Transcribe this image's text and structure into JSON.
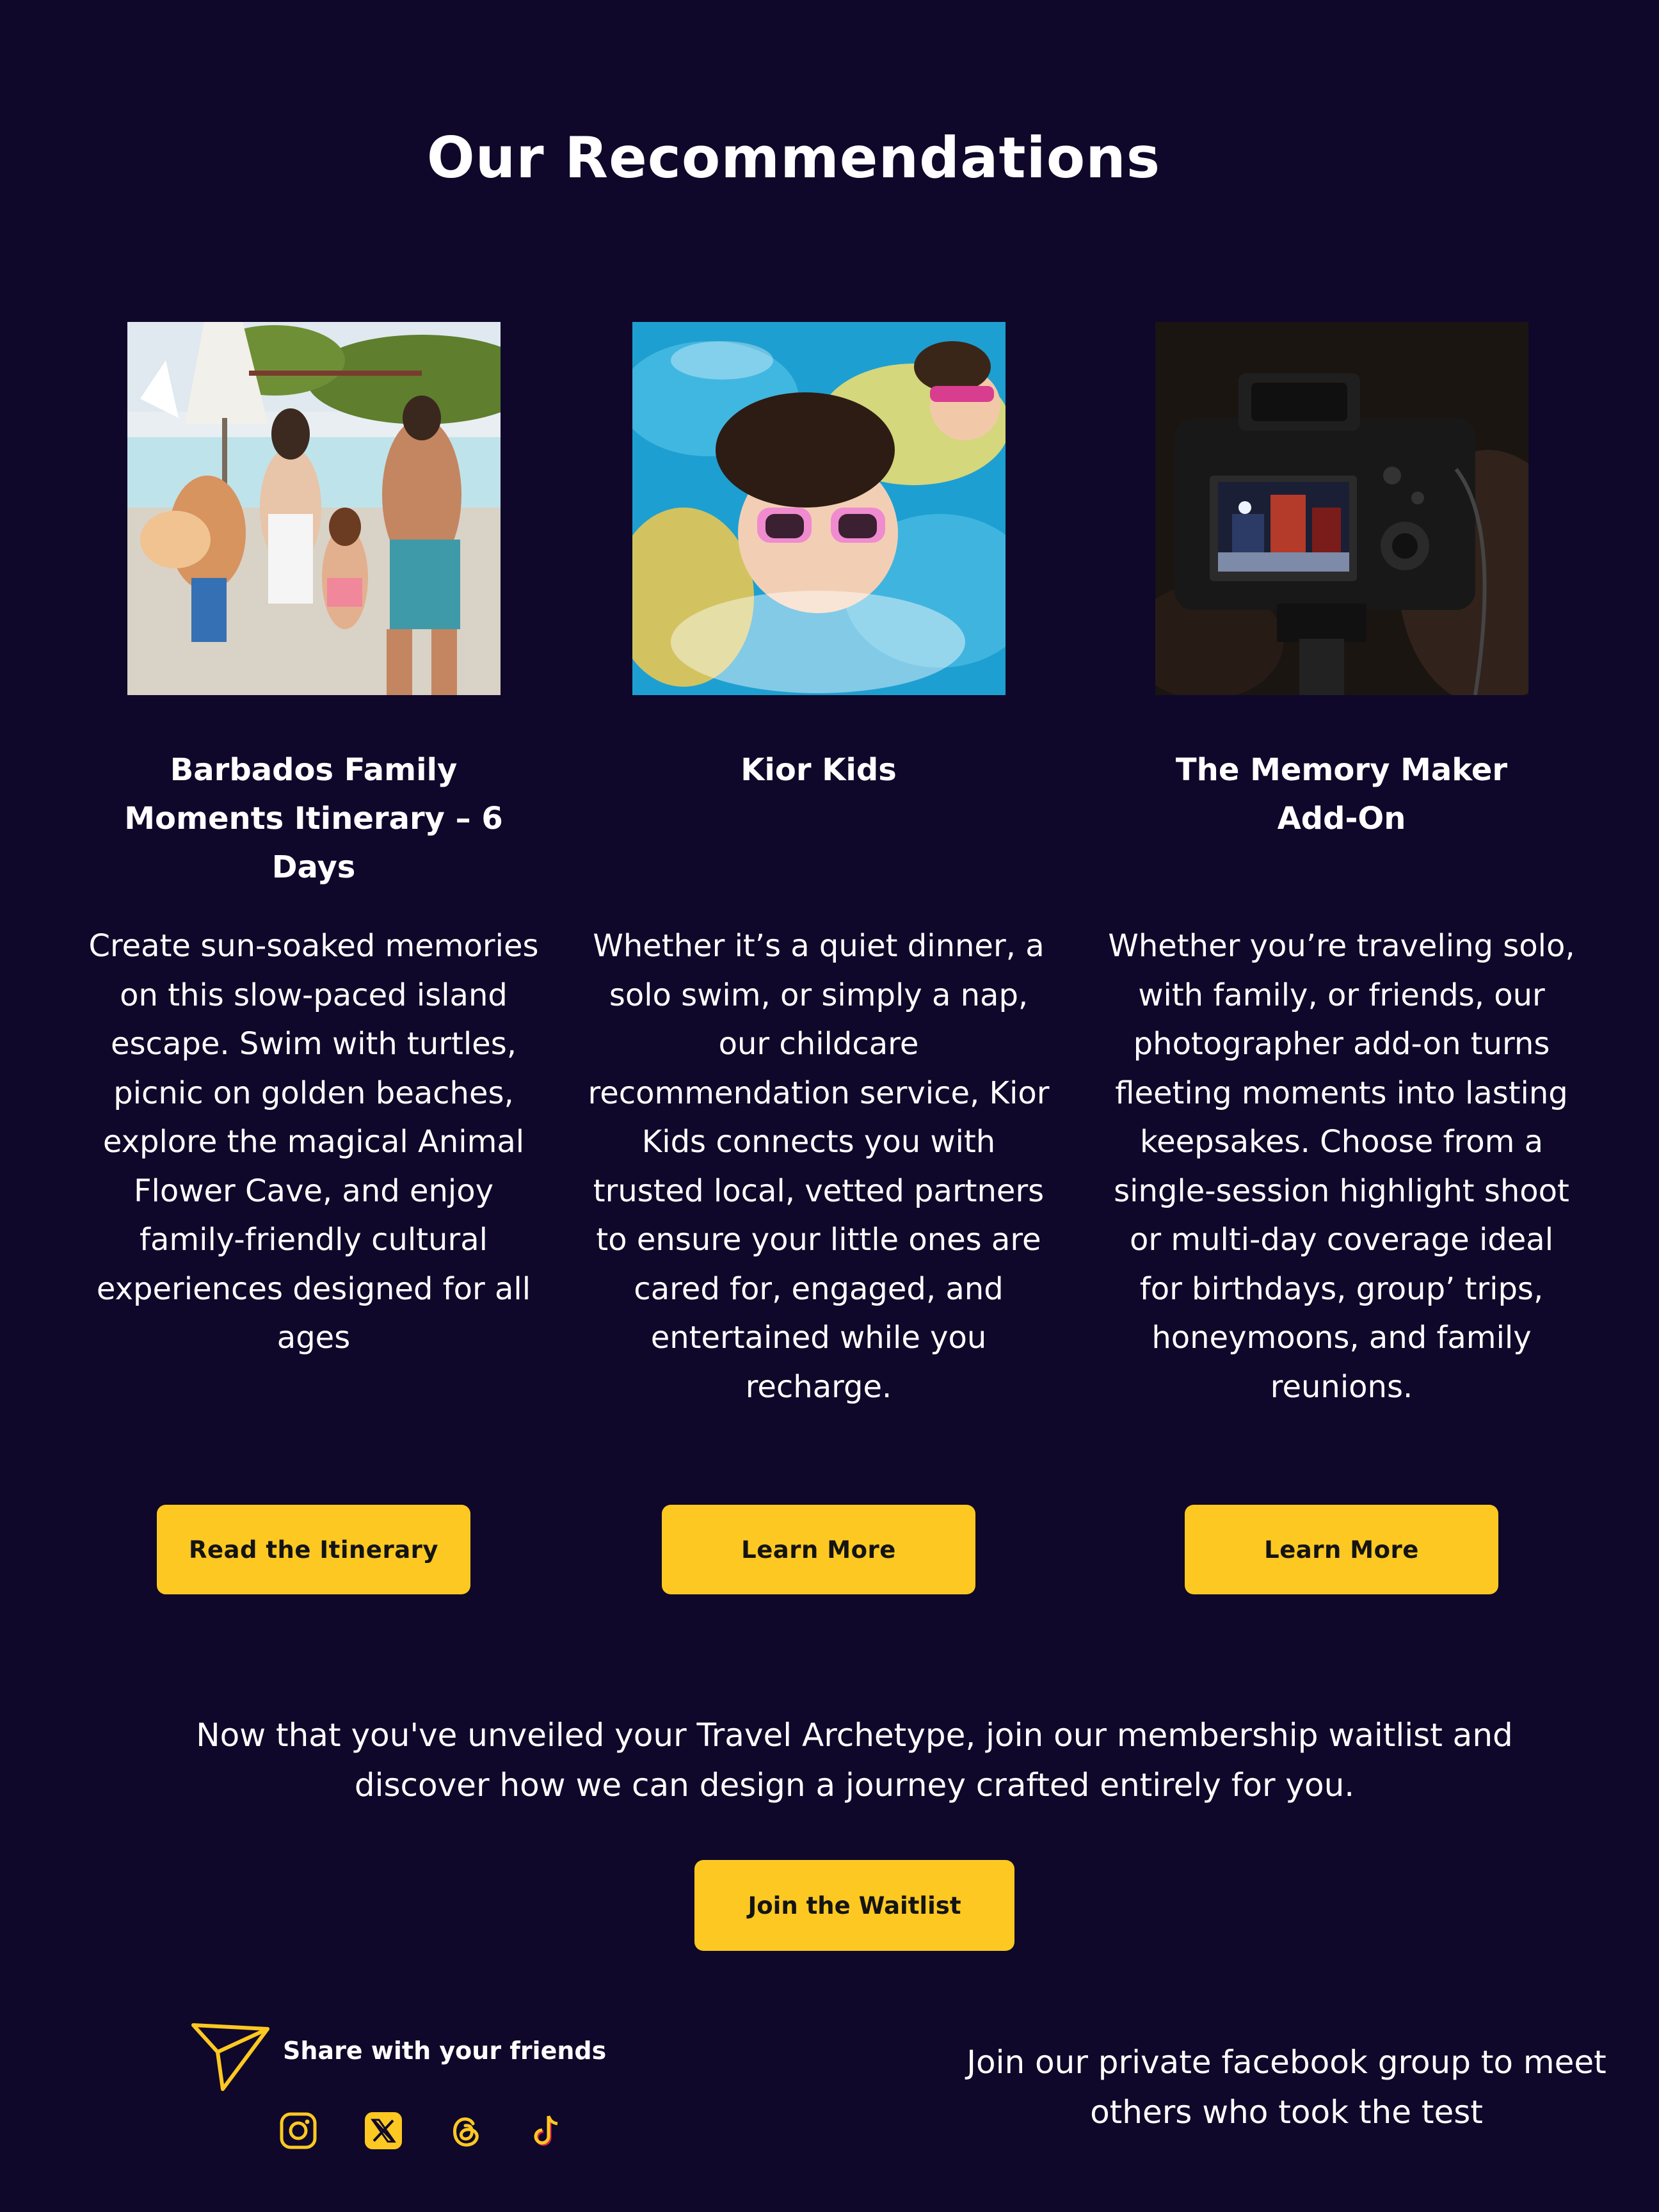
{
  "section": {
    "title": "Our Recommendations"
  },
  "cards": [
    {
      "title": "Barbados Family Moments Itinerary – 6 Days",
      "description": "Create sun-soaked memories on this slow-paced island escape. Swim with turtles, picnic on golden beaches, explore the magical Animal Flower Cave, and enjoy family-friendly cultural experiences designed for all ages",
      "button_label": "Read the Itinerary",
      "image": "family-at-resort-pool-photo"
    },
    {
      "title": "Kior Kids",
      "description": "Whether it’s a quiet dinner, a solo swim, or simply a nap, our childcare recommendation service, Kior Kids connects you with trusted local, vetted partners to ensure your little ones are cared for, engaged, and entertained while you recharge.",
      "button_label": "Learn More",
      "image": "kids-swimming-pool-photo"
    },
    {
      "title": "The Memory Maker Add-On",
      "description": "Whether you’re traveling solo, with family, or friends, our photographer add-on turns fleeting moments into lasting keepsakes. Choose from a single-session highlight shoot or multi-day coverage ideal for birthdays, group’ trips, honeymoons, and family reunions.",
      "button_label": "Learn More",
      "image": "camera-on-tripod-photo"
    }
  ],
  "cta": {
    "text": "Now that you've unveiled your Travel Archetype, join our membership waitlist and discover how we can design a journey crafted entirely for you.",
    "button_label": "Join the Waitlist"
  },
  "footer": {
    "share_label": "Share with your friends",
    "social_icons": [
      "instagram-icon",
      "x-icon",
      "threads-icon",
      "tiktok-icon"
    ],
    "facebook_text": "Join our private facebook group to meet others who took the test"
  },
  "colors": {
    "background": "#0f082a",
    "accent": "#fdc822",
    "text": "#ffffff"
  }
}
